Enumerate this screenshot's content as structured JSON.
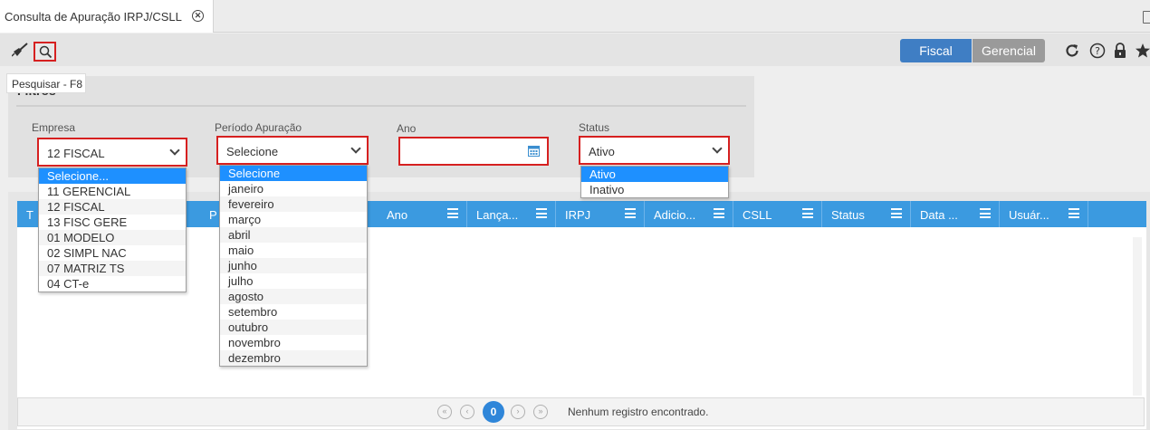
{
  "tab": {
    "title": "Consulta de Apuração IRPJ/CSLL"
  },
  "toolbar": {
    "clear_icon": "broom-icon",
    "search_icon": "search-icon",
    "fiscal_label": "Fiscal",
    "gerencial_label": "Gerencial",
    "accent": "#3f7ec4"
  },
  "tooltip": "Pesquisar - F8",
  "filters": {
    "title": "Filtros",
    "empresa": {
      "label": "Empresa",
      "value": "12 FISCAL",
      "options": [
        "Selecione...",
        "11 GERENCIAL",
        "12 FISCAL",
        "13 FISC GERE",
        "01 MODELO",
        "02 SIMPL NAC",
        "07 MATRIZ TS",
        "04 CT-e"
      ]
    },
    "periodo": {
      "label": "Período Apuração",
      "value": "Selecione",
      "options": [
        "Selecione",
        "janeiro",
        "fevereiro",
        "março",
        "abril",
        "maio",
        "junho",
        "julho",
        "agosto",
        "setembro",
        "outubro",
        "novembro",
        "dezembro"
      ]
    },
    "ano": {
      "label": "Ano",
      "value": ""
    },
    "status": {
      "label": "Status",
      "value": "Ativo",
      "options": [
        "Ativo",
        "Inativo"
      ]
    }
  },
  "grid": {
    "columns": [
      "T",
      "P",
      "Ano",
      "Lança...",
      "IRPJ",
      "Adicio...",
      "CSLL",
      "Status",
      "Data ...",
      "Usuár..."
    ],
    "header_color": "#3b9ae0"
  },
  "pager": {
    "current_page": "0",
    "message": "Nenhum registro encontrado."
  }
}
